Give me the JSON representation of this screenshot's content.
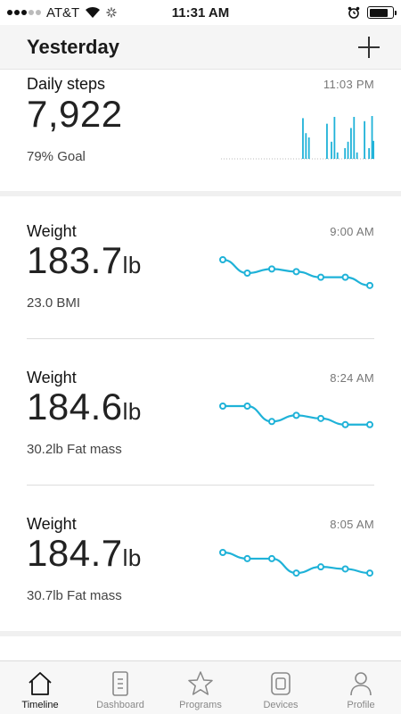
{
  "status_bar": {
    "carrier": "AT&T",
    "time": "11:31 AM"
  },
  "header": {
    "title": "Yesterday",
    "add_icon": "plus-icon"
  },
  "cards": [
    {
      "title": "Daily steps",
      "time": "11:03 PM",
      "value": "7,922",
      "unit": "",
      "sub": "79% Goal",
      "chart_type": "bars",
      "chart_values": [
        0,
        0,
        0,
        0,
        0,
        0,
        0,
        0,
        0,
        0,
        0,
        0,
        0,
        0,
        0,
        0,
        0,
        0,
        0,
        0,
        0,
        0,
        0,
        0,
        0,
        0,
        0,
        0,
        0,
        0,
        0,
        0,
        0,
        0,
        0,
        0,
        0,
        0,
        0,
        0,
        0,
        0,
        0,
        0,
        0,
        0,
        0,
        0,
        0,
        0,
        0,
        0,
        0,
        0,
        0.95,
        0,
        0.6,
        0,
        0.5,
        0,
        0,
        0,
        0,
        0,
        0,
        0,
        0,
        0,
        0,
        0,
        0.82,
        0,
        0,
        0.4,
        0,
        0.98,
        0,
        0.15,
        0,
        0,
        0,
        0,
        0.25,
        0,
        0.4,
        0,
        0.72,
        0,
        0.98,
        0,
        0.15,
        0,
        0,
        0,
        0,
        0.88,
        0,
        0,
        0.25,
        0,
        1.0,
        0.42
      ]
    },
    {
      "title": "Weight",
      "time": "9:00 AM",
      "value": "183.7",
      "unit": "lb",
      "sub": "23.0 BMI",
      "chart_type": "line",
      "chart_values": [
        1.0,
        0.35,
        0.55,
        0.42,
        0.15,
        0.15,
        -0.25
      ]
    },
    {
      "title": "Weight",
      "time": "8:24 AM",
      "value": "184.6",
      "unit": "lb",
      "sub": "30.2lb Fat mass",
      "chart_type": "line",
      "chart_values": [
        1.0,
        1.0,
        0.25,
        0.55,
        0.4,
        0.1,
        0.1
      ]
    },
    {
      "title": "Weight",
      "time": "8:05 AM",
      "value": "184.7",
      "unit": "lb",
      "sub": "30.7lb Fat mass",
      "chart_type": "line",
      "chart_values": [
        1.0,
        0.7,
        0.7,
        0.0,
        0.3,
        0.2,
        0.0
      ]
    }
  ],
  "chart_color": "#1fb2d8",
  "tabs": [
    {
      "label": "Timeline",
      "icon": "home-icon",
      "active": true
    },
    {
      "label": "Dashboard",
      "icon": "document-icon",
      "active": false
    },
    {
      "label": "Programs",
      "icon": "star-icon",
      "active": false
    },
    {
      "label": "Devices",
      "icon": "watch-icon",
      "active": false
    },
    {
      "label": "Profile",
      "icon": "person-icon",
      "active": false
    }
  ]
}
